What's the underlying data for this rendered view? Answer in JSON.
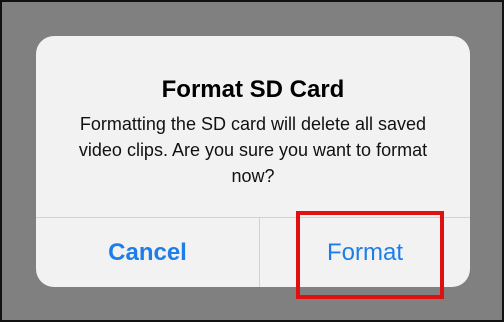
{
  "dialog": {
    "title": "Format SD Card",
    "message": "Formatting the SD card will delete all saved video clips. Are you sure you want to format now?",
    "cancel_label": "Cancel",
    "confirm_label": "Format"
  },
  "colors": {
    "accent": "#1d7ee8",
    "highlight": "#e01010",
    "overlay": "#808080",
    "dialog_background": "#f2f2f3"
  }
}
